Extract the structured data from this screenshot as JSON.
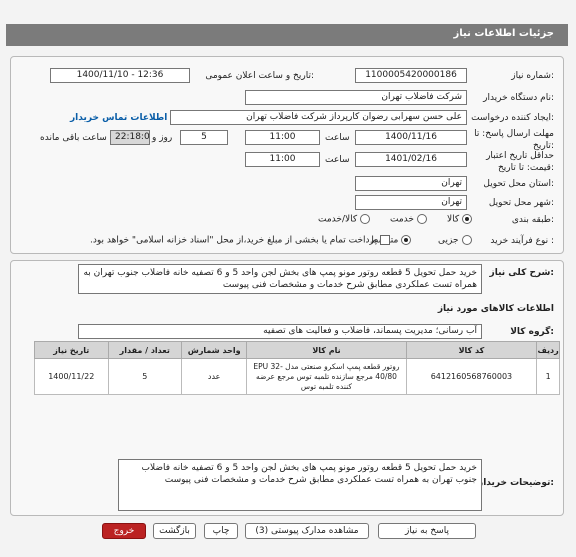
{
  "header": {
    "title": "جزئیات اطلاعات نیاز"
  },
  "form": {
    "need_number_label": "شماره نیاز:",
    "need_number": "1100005420000186",
    "announce_label": "تاریخ و ساعت اعلان عمومی:",
    "announce_value": "1400/11/10 - 12:36",
    "buyer_org_label": "نام دستگاه خریدار:",
    "buyer_org": "شرکت فاضلاب تهران",
    "creator_label": "ایجاد کننده درخواست:",
    "creator": "علی حسن  سهرابی رضوان کارپرداز شرکت فاضلاب تهران",
    "contact_link": "اطلاعات تماس خریدار",
    "deadline_label": "مهلت ارسال پاسخ: تا تاریخ:",
    "deadline_date": "1400/11/16",
    "time_label": "ساعت",
    "deadline_time": "11:00",
    "days_value": "5",
    "days_label": "روز و",
    "remaining_time": "22:18:02",
    "remaining_label": "ساعت باقی مانده",
    "validity_label": "حداقل تاریخ اعتبار قیمت: تا تاریخ:",
    "validity_date": "1401/02/16",
    "validity_time": "11:00",
    "province_label": "استان محل تحویل:",
    "province": "تهران",
    "city_label": "شهر محل تحویل:",
    "city": "تهران",
    "category_label": "طبقه بندی:",
    "category_options": [
      "کالا",
      "خدمت",
      "کالا/خدمت"
    ],
    "process_label": "نوع فرآیند خرید :",
    "process_options": [
      "جزیی",
      "متوسط"
    ],
    "payment_note": "پرداخت تمام یا بخشی از مبلغ خرید،از محل \"اسناد خزانه اسلامی\" خواهد بود."
  },
  "summary": {
    "label": "شرح کلی نیاز:",
    "text": "خرید حمل تحویل 5 قطعه روتور مونو پمپ های بخش لجن واحد 5 و 6 تصفیه خانه فاضلاب جنوب تهران به همراه تست عملکردی مطابق شرح خدمات و مشخصات فنی پیوست"
  },
  "goods": {
    "section_title": "اطلاعات کالاهای مورد نیاز",
    "group_label": "گروه کالا:",
    "group_value": "آب رسانی؛ مدیریت پسماند، فاضلاب و فعالیت های تصفیه",
    "columns": [
      "ردیف",
      "کد کالا",
      "نام کالا",
      "واحد شمارش",
      "تعداد / مقدار",
      "تاریخ نیاز"
    ],
    "rows": [
      {
        "row": "1",
        "code": "6412160568760003",
        "name": "روتور قطعه پمپ اسکرو صنعتی مدل EPU 32-40/80 مرجع سازنده تلمبه توس مرجع عرضه کننده تلمبه توس",
        "unit": "عدد",
        "qty": "5",
        "date": "1400/11/22"
      }
    ]
  },
  "notes": {
    "label": "توضیحات خریدار:",
    "text": "خرید حمل تحویل 5 قطعه روتور مونو پمپ های بخش لجن واحد 5 و 6 تصفیه خانه فاضلاب جنوب تهران به همراه تست عملکردی مطابق شرح خدمات و مشخصات فنی پیوست"
  },
  "buttons": {
    "reply": "پاسخ به نیاز",
    "docs": "مشاهده مدارک پیوستی (3)",
    "print": "چاپ",
    "back": "بازگشت",
    "exit": "خروج"
  }
}
